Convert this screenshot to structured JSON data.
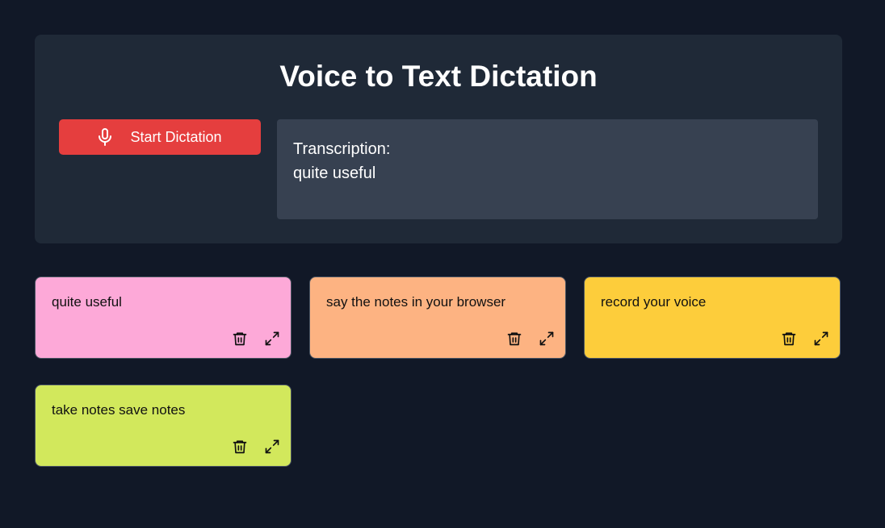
{
  "header": {
    "title": "Voice to Text Dictation"
  },
  "controls": {
    "start_label": "Start Dictation",
    "start_color": "#e53e3e"
  },
  "transcription": {
    "label": "Transcription:",
    "text": "quite useful"
  },
  "notes": [
    {
      "text": "quite useful",
      "color": "#fda9d8"
    },
    {
      "text": "say the notes in your browser",
      "color": "#fdb382"
    },
    {
      "text": "record your voice",
      "color": "#fdcd3b"
    },
    {
      "text": "take notes save notes",
      "color": "#d2e85c"
    }
  ],
  "icons": {
    "start": "microphone-icon",
    "delete": "trash-icon",
    "expand": "expand-icon"
  }
}
